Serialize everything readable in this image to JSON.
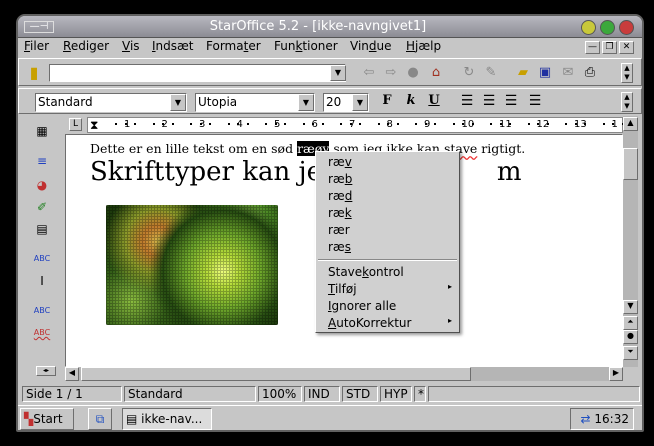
{
  "window": {
    "title": "StarOffice 5.2 - [ikke-navngivet1]"
  },
  "menubar": {
    "items": [
      {
        "text": "Filer",
        "u": "F",
        "rest": "iler"
      },
      {
        "text": "Rediger",
        "u": "R",
        "rest": "ediger"
      },
      {
        "text": "Vis",
        "u": "V",
        "rest": "is"
      },
      {
        "text": "Indsæt",
        "u": "I",
        "rest": "ndsæt"
      },
      {
        "text": "Formater",
        "pre": "Forma",
        "u": "t",
        "rest": "er"
      },
      {
        "text": "Funktioner",
        "pre": "Fun",
        "u": "k",
        "rest": "tioner"
      },
      {
        "text": "Vindue",
        "pre": "Vin",
        "u": "d",
        "rest": "ue"
      },
      {
        "text": "Hjælp",
        "u": "H",
        "rest": "jælp"
      }
    ]
  },
  "url": {
    "value": ""
  },
  "format": {
    "style": "Standard",
    "font": "Utopia",
    "size": "20",
    "bold": "F",
    "italic": "k",
    "underline": "U"
  },
  "ruler": {
    "ticks": [
      "1",
      "2",
      "3",
      "4",
      "5",
      "6",
      "7",
      "8",
      "9",
      "10",
      "11",
      "12",
      "13",
      "1"
    ]
  },
  "document": {
    "line1_pre": "Dette er en lille tekst om en sød ",
    "line1_sel": "ræøv",
    "line1_post": " som jeg ikke kan ",
    "line1_bad": "stave",
    "line1_end": " rigtigt.",
    "heading_pre": "Skrifttyper kan jeg ",
    "heading_post": "m"
  },
  "context_menu": {
    "suggestions": [
      "ræv",
      "ræb",
      "ræd",
      "ræk",
      "rær",
      "ræs"
    ],
    "suggestion_underlined": [
      "v",
      "b",
      "d",
      "k",
      "",
      ""
    ],
    "items": [
      {
        "label": "Stavekontrol",
        "pre": "Stave",
        "u": "k",
        "rest": "ontrol",
        "submenu": false
      },
      {
        "label": "Tilføj",
        "pre": "",
        "u": "T",
        "rest": "ilføj",
        "submenu": true
      },
      {
        "label": "Ignorer alle",
        "pre": "",
        "u": "I",
        "rest": "gnorer alle",
        "submenu": false
      },
      {
        "label": "AutoKorrektur",
        "pre": "",
        "u": "A",
        "rest": "utoKorrektur",
        "submenu": true
      }
    ]
  },
  "statusbar": {
    "page": "Side 1 / 1",
    "style": "Standard",
    "zoom": "100%",
    "ind": "IND",
    "std": "STD",
    "hyp": "HYP",
    "mod": "*"
  },
  "taskbar": {
    "start_label": "Start",
    "task_label": "ikke-nav...",
    "clock": "16:32"
  },
  "icons": {
    "lights": [
      "#c6c63a",
      "#3aa83a",
      "#c83a3a"
    ]
  }
}
